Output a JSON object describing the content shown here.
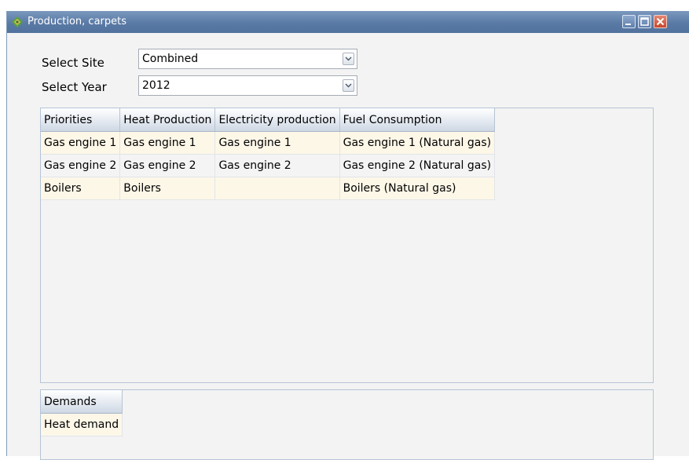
{
  "window": {
    "title": "Production, carpets",
    "icon": "app-logo-icon",
    "controls": [
      "minimize-icon",
      "maximize-icon",
      "close-icon"
    ]
  },
  "filters": {
    "site_label": "Select Site",
    "site_value": "Combined",
    "year_label": "Select Year",
    "year_value": "2012"
  },
  "priorities_table": {
    "columns": [
      "Priorities",
      "Heat Production",
      "Electricity production",
      "Fuel Consumption"
    ],
    "rows": [
      [
        "Gas engine 1",
        "Gas engine 1",
        "Gas engine 1",
        "Gas engine 1 (Natural gas)"
      ],
      [
        "Gas engine 2",
        "Gas engine 2",
        "Gas engine 2",
        "Gas engine 2 (Natural gas)"
      ],
      [
        "Boilers",
        "Boilers",
        "",
        "Boilers (Natural gas)"
      ]
    ]
  },
  "demands_table": {
    "columns": [
      "Demands"
    ],
    "rows": [
      [
        "Heat demand"
      ]
    ]
  },
  "colors": {
    "titlebar": "#5a7aa6",
    "row_highlight": "#fdf7e8",
    "row_alt": "#f4f4f4",
    "panel_border": "#b5c4d6"
  }
}
